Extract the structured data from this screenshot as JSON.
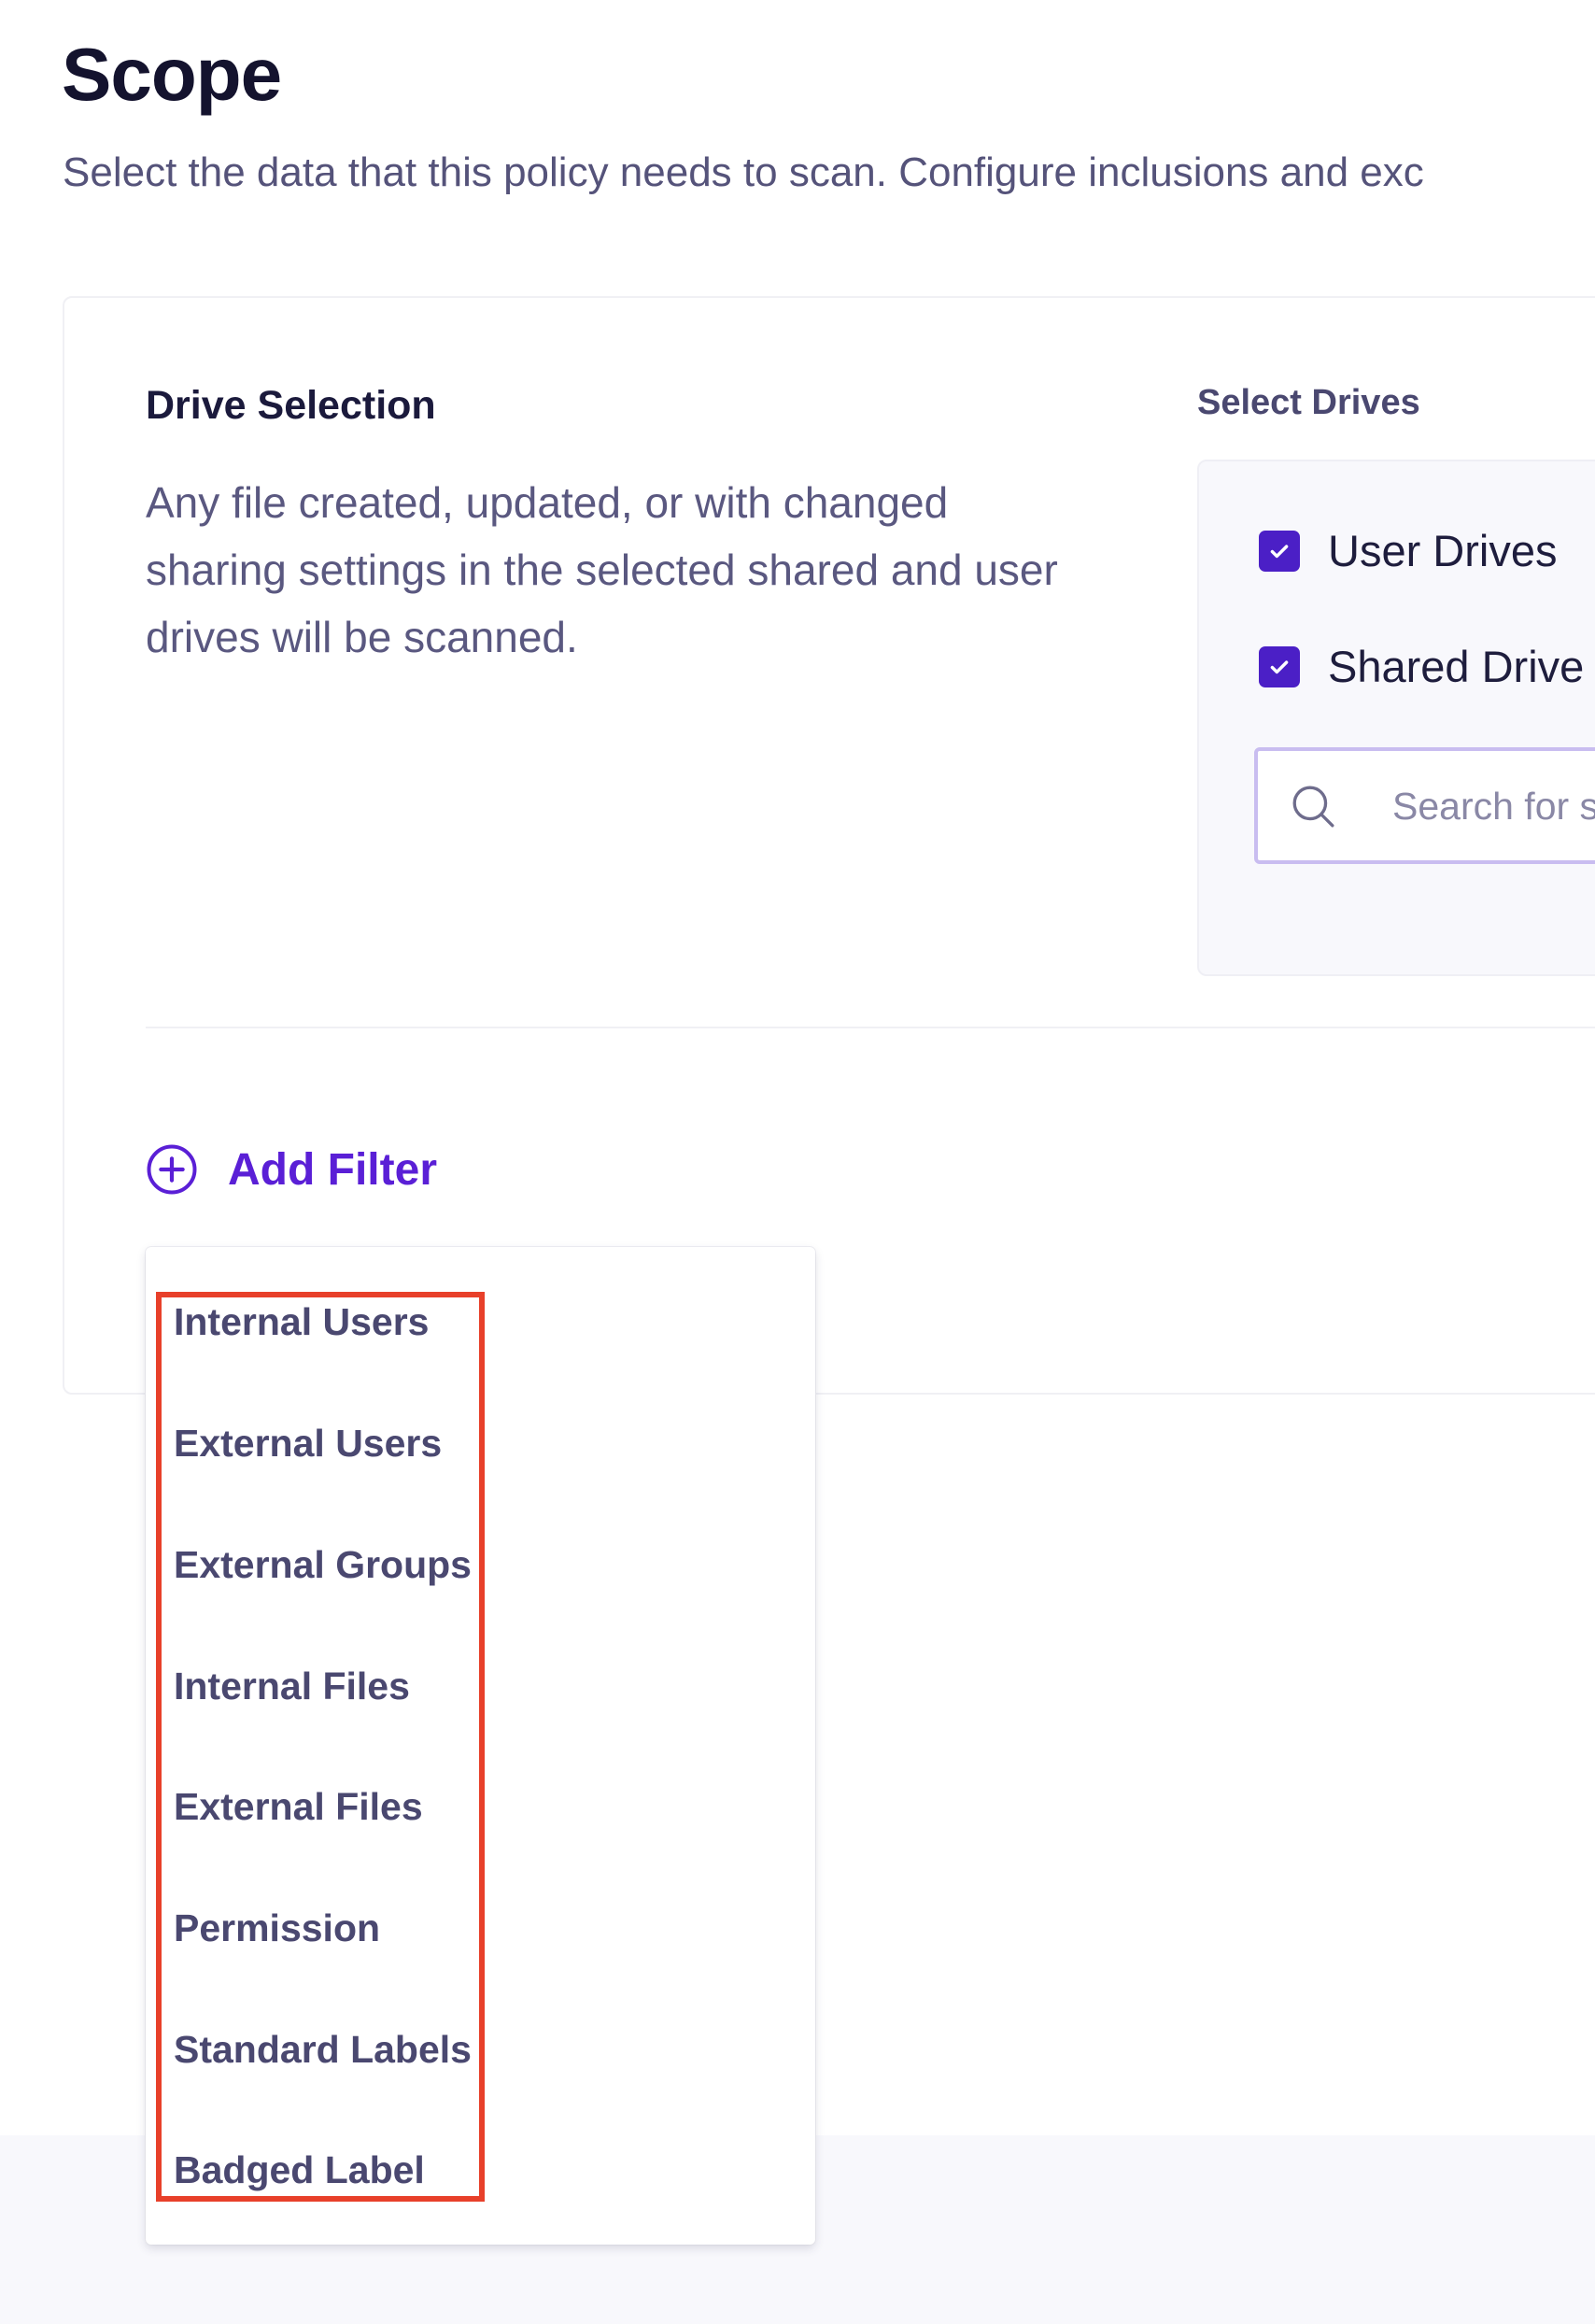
{
  "header": {
    "title": "Scope",
    "subtitle": "Select the data that this policy needs to scan. Configure inclusions and exc"
  },
  "drive_selection": {
    "title": "Drive Selection",
    "description": "Any file created, updated, or with changed sharing settings in the selected shared and user drives will be scanned.",
    "select_drives_label": "Select Drives",
    "options": [
      {
        "label": "User Drives",
        "checked": true
      },
      {
        "label": "Shared Drive",
        "checked": true
      }
    ],
    "search_placeholder": "Search for s"
  },
  "filters": {
    "add_filter_label": "Add Filter",
    "menu_items": [
      "Internal Users",
      "External Users",
      "External Groups",
      "Internal Files",
      "External Files",
      "Permission",
      "Standard Labels",
      "Badged Label"
    ]
  },
  "colors": {
    "accent": "#5a1fd6",
    "checkbox": "#4b1fc6",
    "highlight": "#e8402a"
  }
}
